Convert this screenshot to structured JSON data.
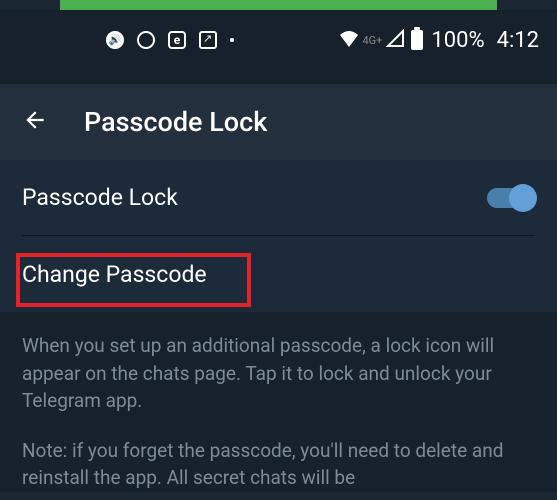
{
  "status_bar": {
    "network_label": "4G+",
    "battery_pct": "100%",
    "time": "4:12"
  },
  "header": {
    "title": "Passcode Lock"
  },
  "settings": {
    "passcode_lock_label": "Passcode Lock",
    "change_passcode_label": "Change Passcode"
  },
  "help": {
    "para1": "When you set up an additional passcode, a lock icon will appear on the chats page. Tap it to lock and unlock your Telegram app.",
    "para2": "Note: if you forget the passcode, you'll need to delete and reinstall the app. All secret chats will be"
  }
}
